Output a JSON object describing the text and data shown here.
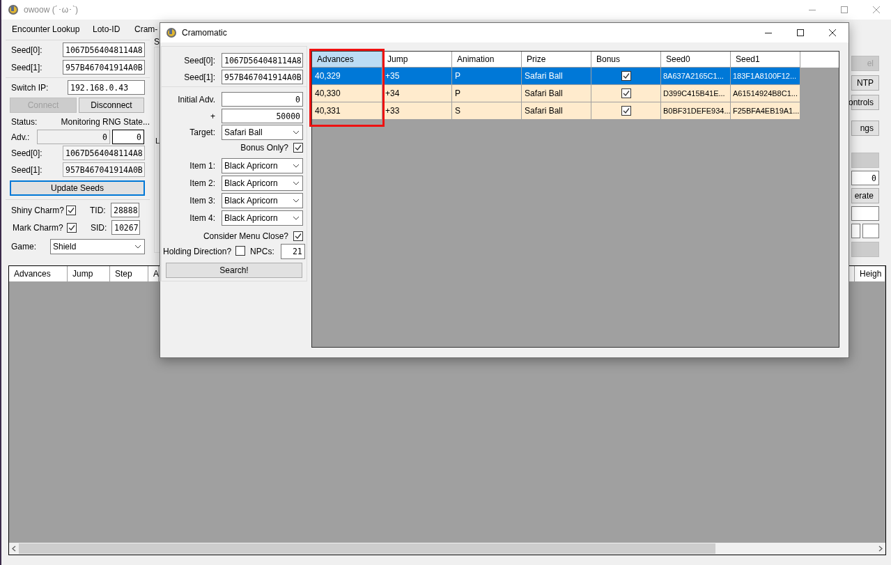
{
  "main_window": {
    "title": "owoow (´･ω･`)",
    "menu": [
      "Encounter Lookup",
      "Loto-ID",
      "Cram-"
    ],
    "seeds": [
      {
        "label": "Seed[0]:",
        "value": "1067D564048114A8"
      },
      {
        "label": "Seed[1]:",
        "value": "957B467041914A0B"
      }
    ],
    "switch_ip": {
      "label": "Switch IP:",
      "value": "192.168.0.43"
    },
    "connection_buttons": [
      {
        "label": "Connect",
        "disabled": true
      },
      {
        "label": "Disconnect",
        "disabled": false
      }
    ],
    "status": {
      "label": "Status:",
      "value": "Monitoring RNG State..."
    },
    "advances": {
      "label": "Adv.:",
      "value": "0",
      "value_2": "0"
    },
    "current_seeds": [
      {
        "label": "Seed[0]:",
        "value": "1067D564048114A8"
      },
      {
        "label": "Seed[1]:",
        "value": "957B467041914A0B"
      }
    ],
    "update_button": "Update Seeds",
    "charms": [
      {
        "label": "Shiny Charm?",
        "checked": true,
        "id_label": "TID:",
        "id_value": "28888"
      },
      {
        "label": "Mark Charm?",
        "checked": true,
        "id_label": "SID:",
        "id_value": "10267"
      }
    ],
    "game": {
      "label": "Game:",
      "value": "Shield"
    },
    "middle_fragments": [
      "S",
      "L"
    ],
    "right_panel": [
      {
        "kind": "button",
        "label": "el",
        "disabled": true
      },
      {
        "kind": "button",
        "label": "NTP",
        "disabled": false
      },
      {
        "kind": "button",
        "label": "ontrols",
        "disabled": false
      },
      {
        "kind": "button",
        "label": "ngs",
        "disabled": false
      },
      {
        "kind": "button",
        "disabled": true
      },
      {
        "kind": "field",
        "value": "0"
      },
      {
        "kind": "button",
        "label": "erate",
        "disabled": false
      },
      {
        "kind": "field"
      },
      {
        "kind": "pair"
      },
      {
        "kind": "button",
        "disabled": true
      }
    ],
    "results_columns": [
      "Advances",
      "Jump",
      "Step",
      "A",
      "",
      "Heigh"
    ]
  },
  "dialog": {
    "title": "Cramomatic",
    "seeds": [
      {
        "label": "Seed[0]:",
        "value": "1067D564048114A8"
      },
      {
        "label": "Seed[1]:",
        "value": "957B467041914A0B"
      }
    ],
    "initial_adv": {
      "label": "Initial Adv.",
      "value": "0"
    },
    "range": {
      "label": "+",
      "value": "50000"
    },
    "target": {
      "label": "Target:",
      "value": "Safari Ball"
    },
    "bonus_only": {
      "label": "Bonus Only?",
      "checked": true
    },
    "items": [
      {
        "label": "Item 1:",
        "value": "Black Apricorn"
      },
      {
        "label": "Item 2:",
        "value": "Black Apricorn"
      },
      {
        "label": "Item 3:",
        "value": "Black Apricorn"
      },
      {
        "label": "Item 4:",
        "value": "Black Apricorn"
      }
    ],
    "consider_menu_close": {
      "label": "Consider Menu Close?",
      "checked": true
    },
    "holding_direction": {
      "label": "Holding Direction?",
      "checked": false
    },
    "npcs": {
      "label": "NPCs:",
      "value": "21"
    },
    "search_button": "Search!",
    "results": {
      "columns": [
        {
          "label": "Advances",
          "selected": true,
          "highlighted": true
        },
        {
          "label": "Jump",
          "selected": false,
          "highlighted": false
        },
        {
          "label": "Animation",
          "selected": false,
          "highlighted": false
        },
        {
          "label": "Prize",
          "selected": false,
          "highlighted": false
        },
        {
          "label": "Bonus",
          "selected": false,
          "highlighted": false
        },
        {
          "label": "Seed0",
          "selected": false,
          "highlighted": false
        },
        {
          "label": "Seed1",
          "selected": false,
          "highlighted": false
        }
      ],
      "rows": [
        {
          "advances": "40,329",
          "jump": "+35",
          "animation": "P",
          "prize": "Safari Ball",
          "bonus": true,
          "seed0": "8A637A2165C1...",
          "seed1": "183F1A8100F12...",
          "selected": true
        },
        {
          "advances": "40,330",
          "jump": "+34",
          "animation": "P",
          "prize": "Safari Ball",
          "bonus": true,
          "seed0": "D399C415B41E...",
          "seed1": "A61514924B8C1...",
          "selected": false
        },
        {
          "advances": "40,331",
          "jump": "+33",
          "animation": "S",
          "prize": "Safari Ball",
          "bonus": true,
          "seed0": "B0BF31DEFE934...",
          "seed1": "F25BFA4EB19A1...",
          "selected": false
        }
      ]
    }
  }
}
